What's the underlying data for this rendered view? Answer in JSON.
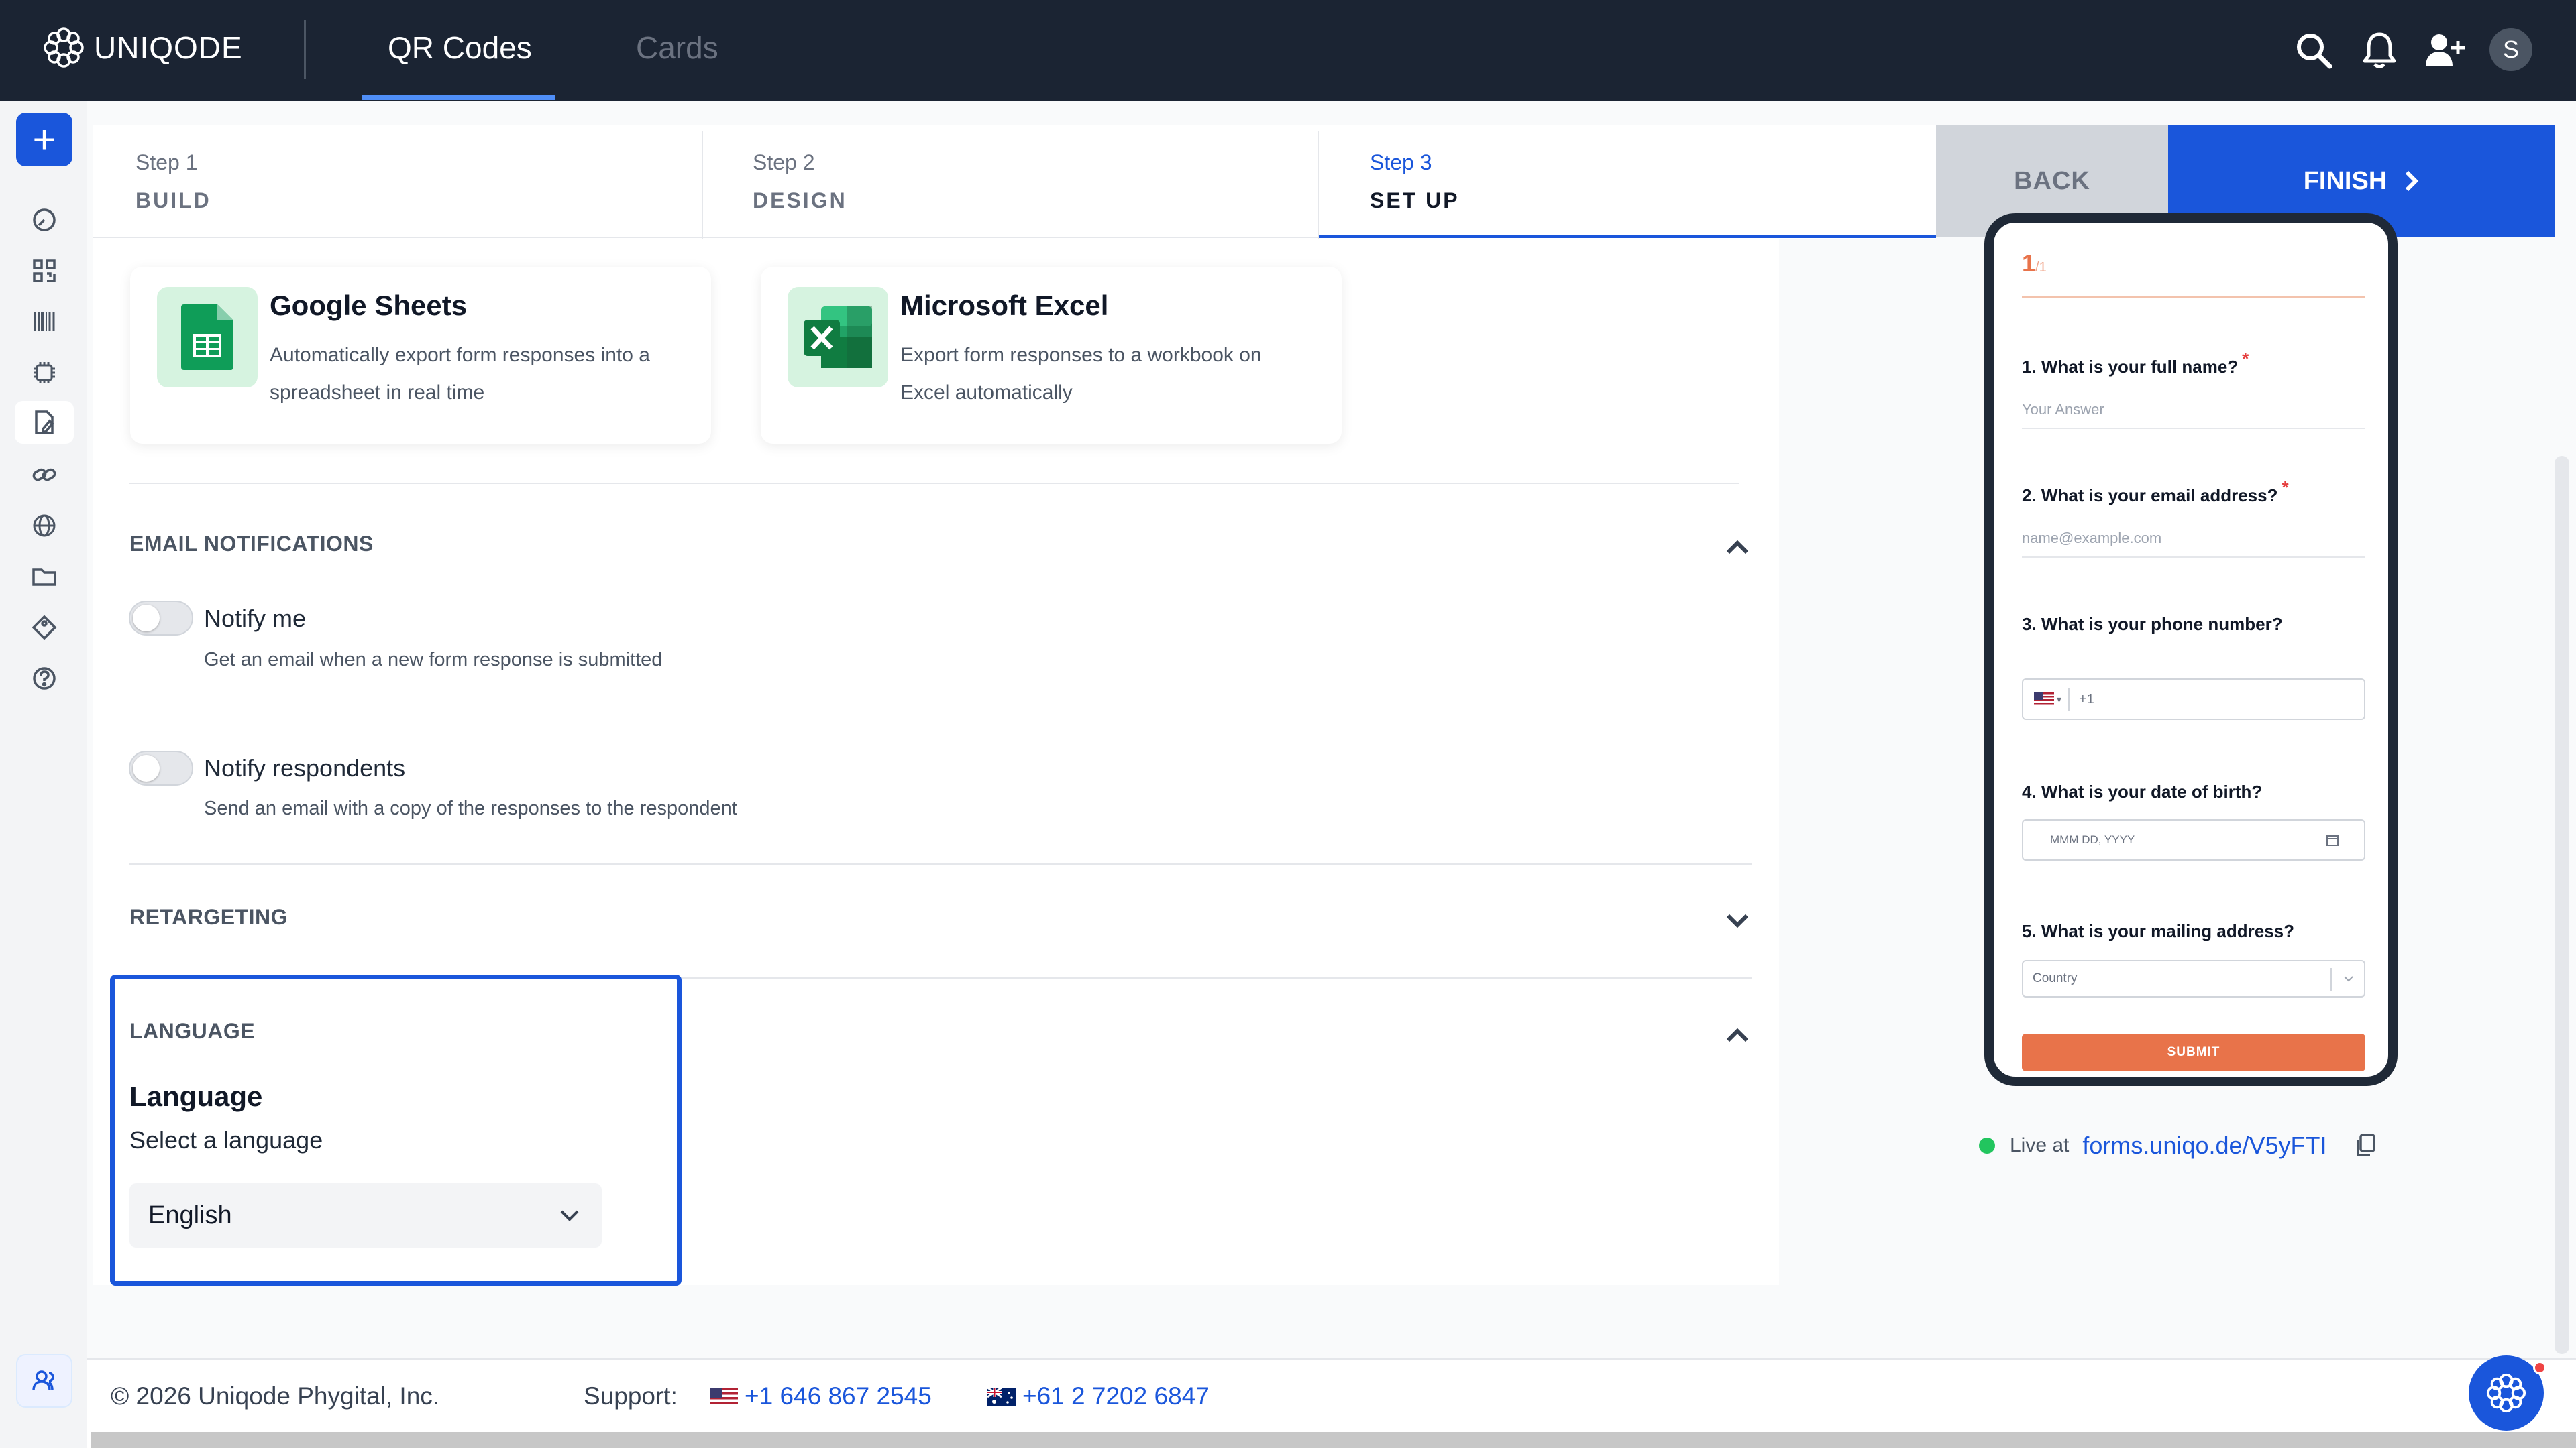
{
  "topbar": {
    "brand": "UNIQODE",
    "tabs": [
      {
        "label": "QR Codes",
        "active": true
      },
      {
        "label": "Cards",
        "active": false
      }
    ],
    "avatar_initial": "S",
    "icons": [
      "search-icon",
      "bell-icon",
      "add-user-icon"
    ]
  },
  "sidebar": {
    "create_label": "+",
    "icons": [
      "dashboard-icon",
      "qr-code-icon",
      "barcode-icon",
      "ai-chip-icon",
      "form-icon",
      "link-icon",
      "globe-icon",
      "folder-icon",
      "tag-icon",
      "help-icon"
    ],
    "bottom_icon": "team-icon"
  },
  "steps": [
    {
      "num": "Step 1",
      "name": "BUILD"
    },
    {
      "num": "Step 2",
      "name": "DESIGN"
    },
    {
      "num": "Step 3",
      "name": "SET UP",
      "active": true
    }
  ],
  "actions": {
    "back": "BACK",
    "finish": "FINISH"
  },
  "integrations": [
    {
      "title": "Google Sheets",
      "desc": "Automatically export form responses into a spreadsheet in real time"
    },
    {
      "title": "Microsoft Excel",
      "desc": "Export form responses to a workbook on Excel automatically"
    }
  ],
  "email": {
    "title": "EMAIL NOTIFICATIONS",
    "notify_me": {
      "label": "Notify me",
      "desc": "Get an email when a new form response is submitted",
      "on": false
    },
    "notify_respondents": {
      "label": "Notify respondents",
      "desc": "Send an email with a copy of the responses to the respondent",
      "on": false
    }
  },
  "retargeting": {
    "title": "RETARGETING"
  },
  "language": {
    "title": "LANGUAGE",
    "heading": "Language",
    "sub": "Select a language",
    "selected": "English"
  },
  "preview": {
    "page": "1",
    "page_total": "/1",
    "q1": "1. What is your full name?",
    "q1_placeholder": "Your Answer",
    "q2": "2. What is your email address?",
    "q2_placeholder": "name@example.com",
    "q3": "3. What is your phone number?",
    "q3_prefix": "+1",
    "q4": "4. What is your date of birth?",
    "q4_placeholder": "MMM DD, YYYY",
    "q5": "5. What is your mailing address?",
    "q5_placeholder": "Country",
    "required_mark": "*",
    "submit": "SUBMIT"
  },
  "live": {
    "label": "Live at",
    "url": "forms.uniqo.de/V5yFTI"
  },
  "footer": {
    "copyright": "© 2026 Uniqode Phygital, Inc.",
    "support_label": "Support:",
    "phone_us": "+1 646 867 2545",
    "phone_au": "+61 2 7202 6847"
  },
  "colors": {
    "accent": "#1a56db",
    "topbar": "#1b2433",
    "form_accent": "#e8734a"
  }
}
